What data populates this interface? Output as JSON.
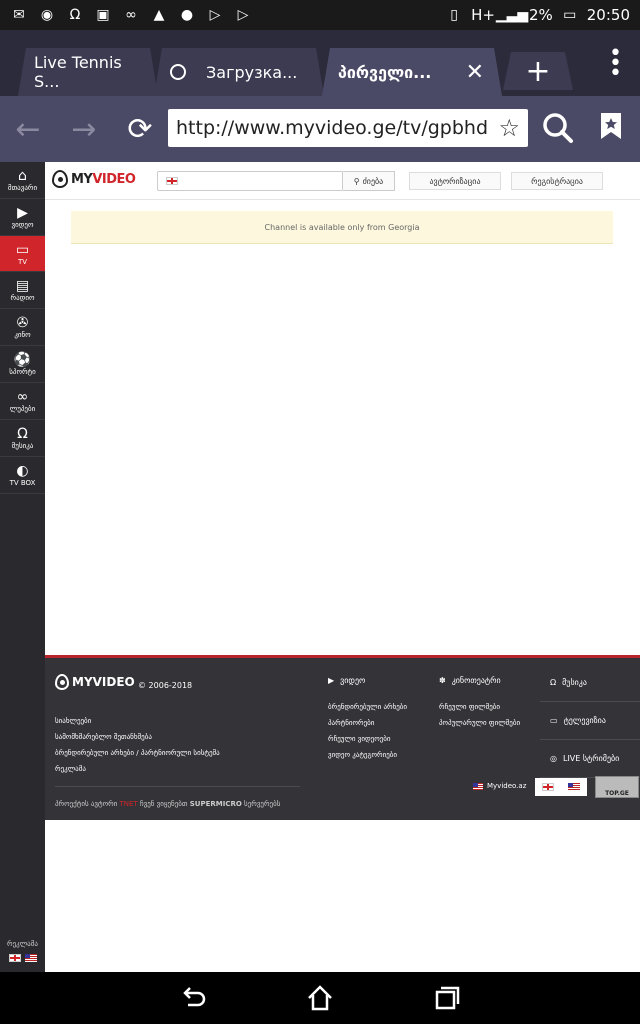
{
  "statusbar": {
    "battery": "2%",
    "time": "20:50",
    "network": "H+"
  },
  "tabs": [
    {
      "title": "Live Tennis S..."
    },
    {
      "title": "Загрузка..."
    },
    {
      "title": "პირველი..."
    }
  ],
  "toolbar": {
    "url": "http://www.myvideo.ge/tv/gpbhd"
  },
  "sidebar": {
    "items": [
      {
        "label": "მთავარი",
        "icon": "home-icon"
      },
      {
        "label": "ვიდეო",
        "icon": "play-icon"
      },
      {
        "label": "TV",
        "icon": "tv-icon"
      },
      {
        "label": "რადიო",
        "icon": "radio-icon"
      },
      {
        "label": "კინო",
        "icon": "camera-icon"
      },
      {
        "label": "სპორტი",
        "icon": "ball-icon"
      },
      {
        "label": "ლუპები",
        "icon": "infinity-icon"
      },
      {
        "label": "მუსიკა",
        "icon": "headphones-icon"
      },
      {
        "label": "TV BOX",
        "icon": "tvbox-icon"
      }
    ],
    "ad_label": "რეკლამა"
  },
  "header": {
    "logo_my": "MY",
    "logo_video": "VIDEO",
    "search_button": "ძიება",
    "login_button": "ავტორიზაცია",
    "register_button": "რეგისტრაცია"
  },
  "notice": "Channel is available only from Georgia",
  "footer": {
    "logo_my": "MY",
    "logo_video": "VIDEO",
    "copyright": "© 2006-2018",
    "links": [
      "სიახლეები",
      "სამომხმარებლო შეთანხმება",
      "ბრენდირებული არხები / პარტნიორული სისტემა",
      "რეკლამა"
    ],
    "credit_prefix": "პროექტის ავტორი",
    "credit_author": "TNET",
    "credit_mid": "ჩვენ ვიყენებთ",
    "credit_vendor": "SUPERMICRO",
    "credit_suffix": "სერვერებს",
    "video_col": {
      "title": "ვიდეო",
      "items": [
        "ბრენდირებული არხები",
        "პარტნიორები",
        "რჩეული ვიდეოები",
        "ვიდეო კატეგორიები"
      ]
    },
    "cinema_col": {
      "title": "კინოთეატრი",
      "items": [
        "რჩეული ფილმები",
        "პოპულარული ფილმები"
      ]
    },
    "right_items": [
      "მუსიკა",
      "ტელევიზია",
      "LIVE სტრიმები"
    ],
    "az_link": "Myvideo.az",
    "counter": "TOP.GE"
  }
}
